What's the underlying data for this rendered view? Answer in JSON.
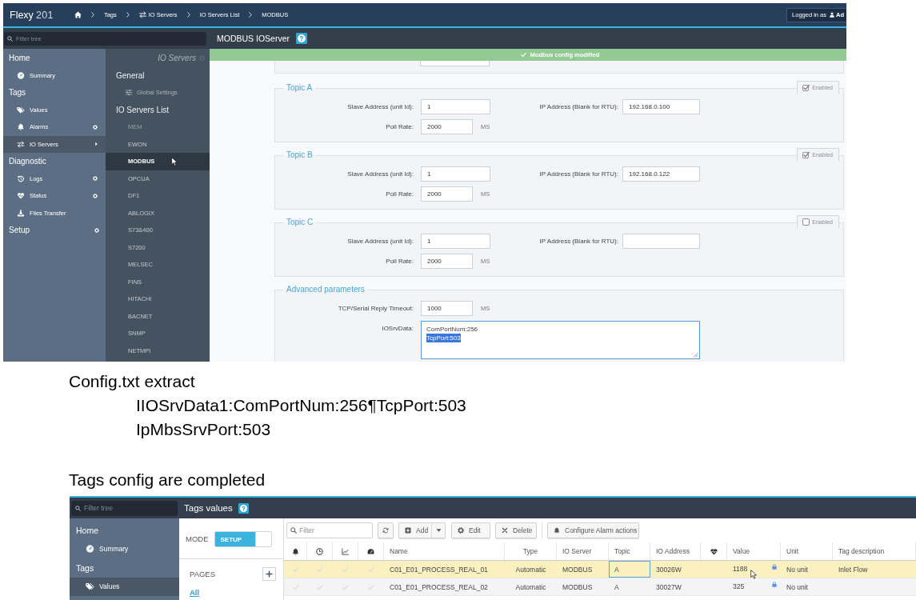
{
  "top_screen": {
    "top_bar": {
      "logo": {
        "name": "Flexy",
        "model": "201"
      },
      "breadcrumb": [
        {
          "kind": "home"
        },
        {
          "kind": "link",
          "label": "Tags"
        },
        {
          "kind": "transfer",
          "label": "IO Servers"
        },
        {
          "kind": "link",
          "label": "IO Servers List"
        },
        {
          "kind": "link",
          "label": "MODBUS"
        }
      ],
      "user": {
        "prefix": "Logged in as",
        "name": "Ad"
      }
    },
    "filter_tree": {
      "placeholder": "Filter tree"
    },
    "page_title": "MODBUS IOServer",
    "sidebar": [
      {
        "label": "Home",
        "configurable": false,
        "children": [
          {
            "label": "Summary",
            "kind": "gauge",
            "selected": false,
            "configurable": false
          }
        ]
      },
      {
        "label": "Tags",
        "configurable": false,
        "children": [
          {
            "label": "Values",
            "kind": "tags",
            "selected": false,
            "configurable": false
          },
          {
            "label": "Alarms",
            "kind": "bell",
            "selected": false,
            "configurable": true
          },
          {
            "label": "IO Servers",
            "kind": "transfer",
            "selected": true,
            "configurable": false
          }
        ]
      },
      {
        "label": "Diagnostic",
        "configurable": false,
        "children": [
          {
            "label": "Logs",
            "kind": "history",
            "selected": false,
            "configurable": true
          },
          {
            "label": "Status",
            "kind": "heartbeat",
            "selected": false,
            "configurable": true
          },
          {
            "label": "Files Transfer",
            "kind": "download",
            "selected": false,
            "configurable": false
          }
        ]
      },
      {
        "label": "Setup",
        "configurable": true
      }
    ],
    "subnav": {
      "title": "IO Servers",
      "groups": [
        {
          "label": "General",
          "children": [
            {
              "label": "Global Settings",
              "kind": "sliders",
              "selected": false,
              "disabled": false
            }
          ]
        },
        {
          "label": "IO Servers List",
          "children": [
            {
              "label": "MEM",
              "selected": false,
              "disabled": true
            },
            {
              "label": "EWON",
              "selected": false,
              "disabled": false
            },
            {
              "label": "MODBUS",
              "selected": true,
              "disabled": false
            },
            {
              "label": "OPCUA",
              "selected": false,
              "disabled": false
            },
            {
              "label": "DF1",
              "selected": false,
              "disabled": false
            },
            {
              "label": "ABLOGIX",
              "selected": false,
              "disabled": false
            },
            {
              "label": "S73&400",
              "selected": false,
              "disabled": false
            },
            {
              "label": "S7200",
              "selected": false,
              "disabled": false
            },
            {
              "label": "MELSEC",
              "selected": false,
              "disabled": false
            },
            {
              "label": "FINS",
              "selected": false,
              "disabled": false
            },
            {
              "label": "HITACHI",
              "selected": false,
              "disabled": false
            },
            {
              "label": "BACNET",
              "selected": false,
              "disabled": false
            },
            {
              "label": "SNMP",
              "selected": false,
              "disabled": false
            },
            {
              "label": "NETMPI",
              "selected": false,
              "disabled": false
            }
          ]
        }
      ]
    },
    "notification": {
      "text": "Modbus config modified"
    },
    "panels": [
      {
        "legend": "Topic A",
        "enabled": {
          "label": "Enabled",
          "checked": true
        },
        "rows": [
          [
            {
              "kind": "input",
              "label": "Slave Address (unit Id):",
              "value": "1"
            },
            {
              "kind": "input",
              "label": "IP Address (Blank for RTU):",
              "value": "192.168.0.100"
            }
          ],
          [
            {
              "kind": "input",
              "label": "Poll Rate:",
              "value": "2000",
              "unit": "MS"
            }
          ]
        ]
      },
      {
        "legend": "Topic B",
        "enabled": {
          "label": "Enabled",
          "checked": true
        },
        "rows": [
          [
            {
              "kind": "input",
              "label": "Slave Address (unit Id):",
              "value": "1"
            },
            {
              "kind": "input",
              "label": "IP Address (Blank for RTU):",
              "value": "192.168.0.122"
            }
          ],
          [
            {
              "kind": "input",
              "label": "Poll Rate:",
              "value": "2000",
              "unit": "MS"
            }
          ]
        ]
      },
      {
        "legend": "Topic C",
        "enabled": {
          "label": "Enabled",
          "checked": false
        },
        "rows": [
          [
            {
              "kind": "input",
              "label": "Slave Address (unit Id):",
              "value": "1"
            },
            {
              "kind": "input",
              "label": "IP Address (Blank for RTU):"
            }
          ],
          [
            {
              "kind": "input",
              "label": "Poll Rate:",
              "value": "2000",
              "unit": "MS"
            }
          ]
        ]
      },
      {
        "legend": "Advanced parameters",
        "rows": [
          [
            {
              "kind": "input",
              "label": "TCP/Serial Reply Timeout:",
              "value": "1000",
              "unit": "MS"
            }
          ],
          [
            {
              "kind": "textarea",
              "label": "IOSrvData:",
              "lines": [
                {
                  "text": "ComPortNum:256",
                  "selected": false
                },
                {
                  "text": "TcpPort:503",
                  "selected": true
                }
              ]
            }
          ]
        ]
      }
    ]
  },
  "notes": {
    "config_caption": "Config.txt extract",
    "config_lines": [
      "IIOSrvData1:ComPortNum:256¶TcpPort:503",
      "IpMbsSrvPort:503"
    ],
    "tags_caption": "Tags config are completed"
  },
  "bottom_screen": {
    "filter_tree": {
      "placeholder": "Filter tree"
    },
    "page_title": "Tags values",
    "sidebar": [
      {
        "label": "Home",
        "children": [
          {
            "label": "Summary",
            "kind": "gauge",
            "selected": false
          }
        ]
      },
      {
        "label": "Tags",
        "children": [
          {
            "label": "Values",
            "kind": "tags",
            "selected": true
          }
        ]
      }
    ],
    "mode": {
      "label": "MODE",
      "toggle": {
        "label": "SETUP",
        "on": true
      }
    },
    "pages": {
      "label": "PAGES",
      "items": [
        {
          "label": "All",
          "selected": true
        }
      ]
    },
    "toolbar": {
      "filter": {
        "placeholder": "Filter"
      },
      "buttons": [
        {
          "kind": "refresh"
        },
        {
          "kind": "add",
          "label": "Add"
        },
        {
          "kind": "dropdown"
        },
        {
          "kind": "edit",
          "label": "Edit"
        },
        {
          "kind": "delete",
          "label": "Delete"
        },
        {
          "kind": "alarm",
          "label": "Configure Alarm actions"
        }
      ]
    },
    "table": {
      "columns": [
        {
          "kind": "bell"
        },
        {
          "kind": "clock"
        },
        {
          "kind": "chart"
        },
        {
          "kind": "speedometer"
        },
        {
          "kind": "text",
          "label": "Name"
        },
        {
          "kind": "text",
          "label": "Type"
        },
        {
          "kind": "text",
          "label": "IO Server"
        },
        {
          "kind": "text",
          "label": "Topic"
        },
        {
          "kind": "text",
          "label": "IO Address"
        },
        {
          "kind": "heartbeat"
        },
        {
          "kind": "text",
          "label": "Value"
        },
        {
          "kind": "text",
          "label": "Unit"
        },
        {
          "kind": "text",
          "label": "Tag description"
        }
      ],
      "rows": [
        {
          "selected": true,
          "flags": [
            false,
            false,
            false,
            false
          ],
          "name": "C01_E01_PROCESS_REAL_01",
          "type": "Automatic",
          "io_server": "MODBUS",
          "topic": {
            "text": "A",
            "focused": true
          },
          "io_address": "30026W",
          "value": "1188",
          "locked": true,
          "unit": "No unit",
          "description": "Inlet Flow"
        },
        {
          "selected": false,
          "flags": [
            false,
            false,
            false,
            false
          ],
          "name": "C01_E01_PROCESS_REAL_02",
          "type": "Automatic",
          "io_server": "MODBUS",
          "topic": {
            "text": "A",
            "focused": false
          },
          "io_address": "30027W",
          "value": "325",
          "locked": true,
          "unit": "No unit"
        }
      ]
    }
  }
}
